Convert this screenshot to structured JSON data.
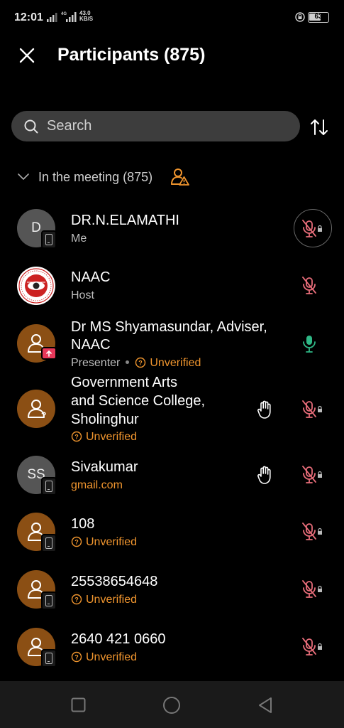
{
  "status": {
    "time": "12:01",
    "net_signal_label": "4G",
    "net_speed_value": "43.0",
    "net_speed_unit": "KB/S",
    "battery": "63",
    "battery_level": 0.63
  },
  "header": {
    "title": "Participants (875)"
  },
  "search": {
    "placeholder": "Search"
  },
  "section": {
    "label": "In the meeting (875)"
  },
  "participants": [
    {
      "initials": "D",
      "name": "DR.N.ELAMATHI",
      "subtitle": "Me",
      "mic": "muted-locked"
    },
    {
      "name": "NAAC",
      "subtitle": "Host",
      "mic": "muted"
    },
    {
      "name_line1": "Dr MS Shyamasundar, Adviser,",
      "name_line2": "NAAC",
      "role": "Presenter",
      "status": "Unverified",
      "mic": "active"
    },
    {
      "name_line1": "Government  Arts",
      "name_line2": "and Science College,",
      "name_line3": "Sholinghur",
      "status": "Unverified",
      "hand_raised": true,
      "mic": "muted-locked"
    },
    {
      "initials": "SS",
      "name": "Sivakumar",
      "subtitle": "gmail.com",
      "hand_raised": true,
      "mic": "muted-locked"
    },
    {
      "name": "108",
      "status": "Unverified",
      "mic": "muted-locked"
    },
    {
      "name": "25538654648",
      "status": "Unverified",
      "mic": "muted-locked"
    },
    {
      "name": "2640 421 0660",
      "status": "Unverified",
      "mic": "muted-locked"
    }
  ],
  "colors": {
    "accent_orange": "#f0952e",
    "muted_red": "#e86d7a",
    "active_green": "#2fb886",
    "avatar_brown": "#8b4f14"
  }
}
